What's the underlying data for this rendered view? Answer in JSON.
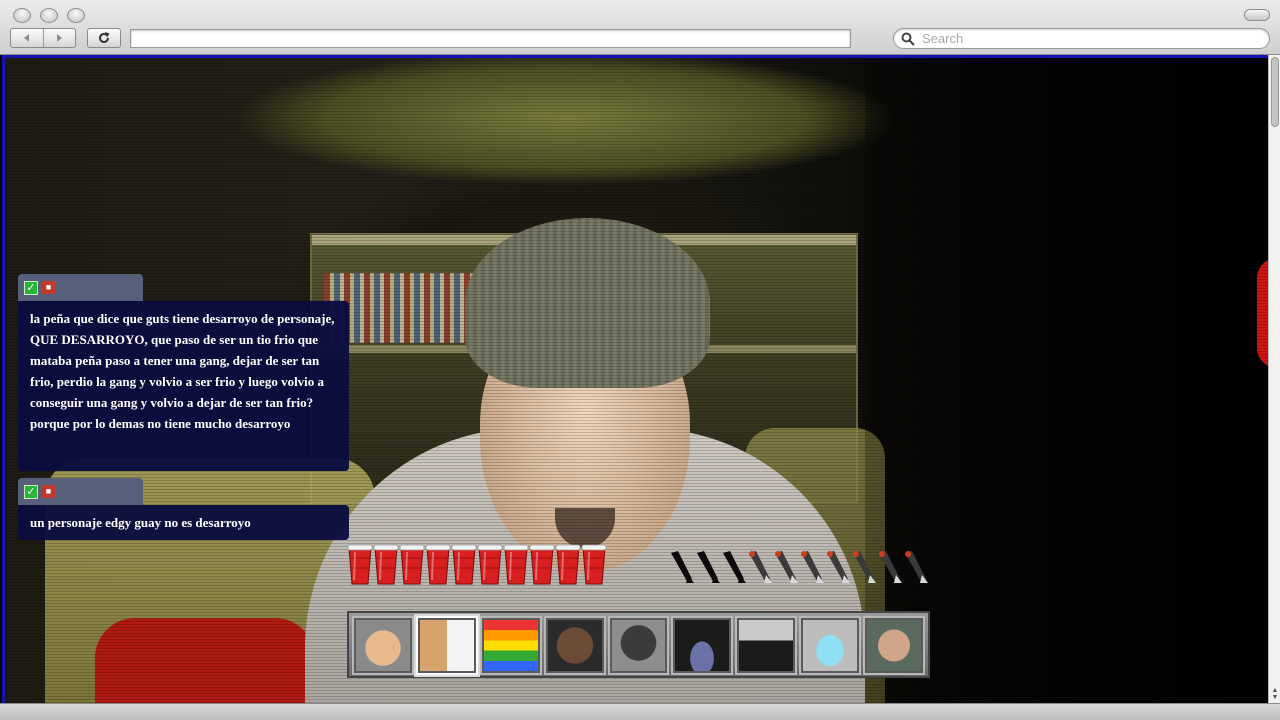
{
  "browser": {
    "search_placeholder": "Search",
    "url_value": ""
  },
  "chat": {
    "messages": [
      {
        "text": "la peña que dice que guts tiene desarroyo de personaje, QUE DESARROYO, que paso de ser un tio frio que mataba peña paso a tener una gang, dejar de ser tan frio, perdio la gang y volvio a ser frio y luego volvio a conseguir una gang y volvio a dejar de ser tan frio? porque por lo demas no tiene mucho desarroyo"
      },
      {
        "text": "un personaje edgy guay no es desarroyo"
      }
    ]
  },
  "hud": {
    "cups_remaining": 10,
    "darts_total": 10,
    "darts_filled": 3,
    "characters": [
      {
        "name": "sumo-character",
        "active": false
      },
      {
        "name": "cat-dog-character",
        "active": true
      },
      {
        "name": "shrek-character",
        "active": false
      },
      {
        "name": "man-face-character",
        "active": false
      },
      {
        "name": "gorilla-character",
        "active": false
      },
      {
        "name": "dance-floor-character",
        "active": false
      },
      {
        "name": "suit-man-character",
        "active": false
      },
      {
        "name": "ice-skater-character",
        "active": false
      },
      {
        "name": "selfie-man-character",
        "active": false
      }
    ]
  },
  "colors": {
    "chat_bg": "#0a0c40",
    "badge_bg": "#56607b",
    "cup_red": "#d81e1e",
    "viewport_border": "#1414b0"
  }
}
